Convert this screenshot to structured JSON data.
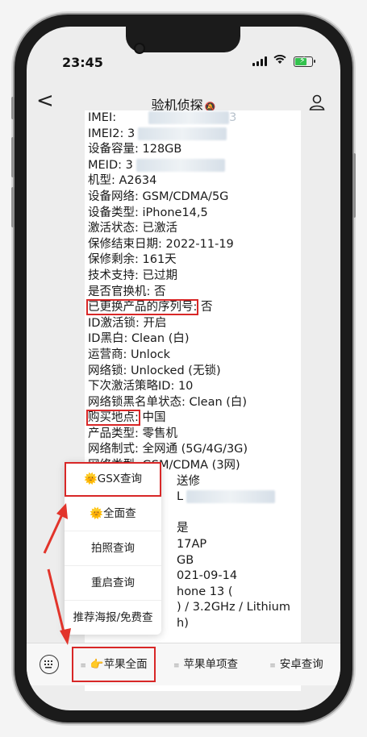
{
  "status_bar": {
    "time": "23:45"
  },
  "nav": {
    "back": "<",
    "title": "验机侦探",
    "mute_icon": "🔕"
  },
  "info_lines": [
    {
      "label": "IMEI:",
      "value": "",
      "blurred": true,
      "tail": "3"
    },
    {
      "label": "IMEI2: ",
      "value": "3",
      "blurred": true
    },
    {
      "label": "设备容量: ",
      "value": "128GB"
    },
    {
      "label": "MEID: ",
      "value": "3",
      "blurred": true
    },
    {
      "label": "机型: ",
      "value": "A2634"
    },
    {
      "label": "设备网络: ",
      "value": "GSM/CDMA/5G"
    },
    {
      "label": "设备类型: ",
      "value": "iPhone14,5"
    },
    {
      "label": "激活状态: ",
      "value": "已激活"
    },
    {
      "label": "保修结束日期: ",
      "value": "2022-11-19"
    },
    {
      "label": "保修剩余: ",
      "value": "161天"
    },
    {
      "label": "技术支持: ",
      "value": "已过期"
    },
    {
      "label": "是否官换机: ",
      "value": "否"
    },
    {
      "label": "已更换产品的序列号:",
      "value": " 否",
      "highlight": true
    },
    {
      "label": "ID激活锁: ",
      "value": "开启"
    },
    {
      "label": "ID黑白: ",
      "value": "Clean (白)"
    },
    {
      "label": "运营商: ",
      "value": "Unlock"
    },
    {
      "label": "网络锁: ",
      "value": "Unlocked (无锁)"
    },
    {
      "label": "下次激活策略ID: ",
      "value": "10"
    },
    {
      "label": "网络锁黑名单状态: ",
      "value": "Clean (白)"
    },
    {
      "label": "购买地点:",
      "value": " 中国",
      "highlight": true
    },
    {
      "label": "产品类型: ",
      "value": "零售机"
    },
    {
      "label": "网络制式: ",
      "value": "全网通 (5G/4G/3G)"
    },
    {
      "label": "网络类型: ",
      "value": "GSM/CDMA (3网)"
    },
    {
      "label": "",
      "value": "送修",
      "offset": true
    },
    {
      "label": "",
      "value": "L",
      "blurred": true,
      "offset": true
    },
    {
      "label": "",
      "value": "",
      "offset": true
    },
    {
      "label": "",
      "value": "是",
      "offset": true
    },
    {
      "label": "",
      "value": "17AP",
      "offset": true
    },
    {
      "label": "",
      "value": "GB",
      "offset": true
    },
    {
      "label": "",
      "value": "021-09-14",
      "offset": true
    },
    {
      "label": "",
      "value": "hone 13 (",
      "offset": true
    },
    {
      "label": "",
      "value": ") / 3.2GHz / Lithium",
      "offset": true
    },
    {
      "label": "",
      "value": "h)",
      "offset": true
    }
  ],
  "popup_menu": [
    {
      "label": "🌞GSX查询",
      "boxed": true
    },
    {
      "label": "🌞全面查"
    },
    {
      "label": "拍照查询"
    },
    {
      "label": "重启查询"
    },
    {
      "label": "推荐海报/免费查"
    }
  ],
  "tabbar": {
    "tabs": [
      {
        "label": "👉苹果全面",
        "boxed": true
      },
      {
        "label": "苹果单项查"
      },
      {
        "label": "安卓查询"
      }
    ]
  },
  "colors": {
    "highlight": "#d82727",
    "battery": "#33c24d"
  }
}
